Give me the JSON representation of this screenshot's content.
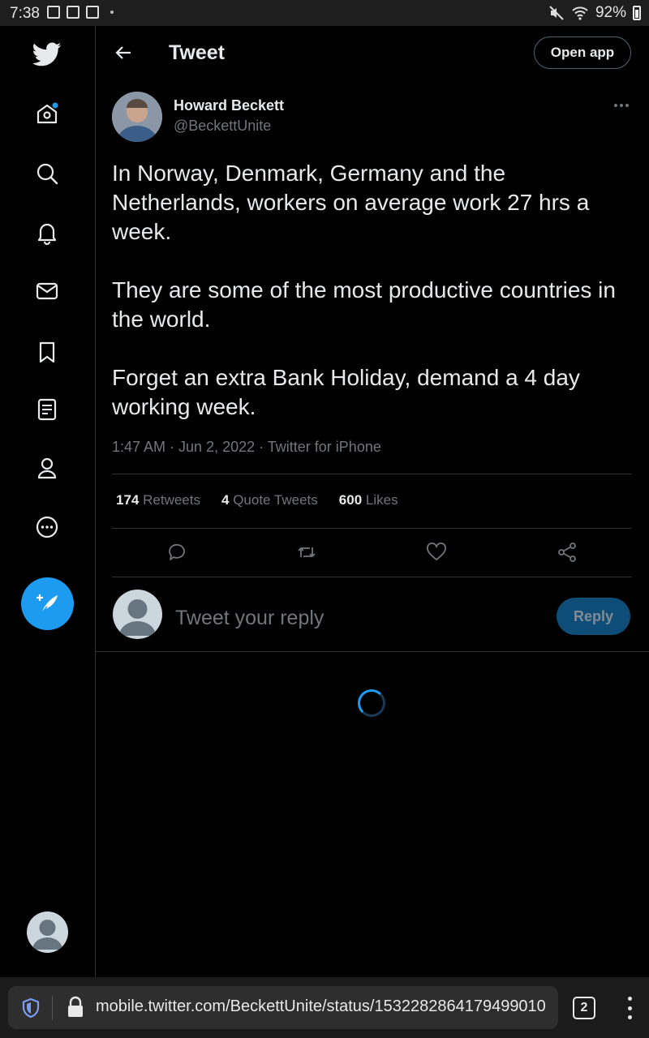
{
  "status_bar": {
    "time": "7:38",
    "battery": "92%"
  },
  "sidebar": {
    "items": [
      {
        "icon": "twitter-logo-icon"
      },
      {
        "icon": "home-icon"
      },
      {
        "icon": "search-icon"
      },
      {
        "icon": "notifications-bell-icon"
      },
      {
        "icon": "messages-envelope-icon"
      },
      {
        "icon": "bookmarks-icon"
      },
      {
        "icon": "lists-icon"
      },
      {
        "icon": "profile-icon"
      },
      {
        "icon": "more-icon"
      }
    ],
    "compose_icon": "compose-feather-icon"
  },
  "header": {
    "title": "Tweet",
    "open_app_label": "Open app"
  },
  "tweet": {
    "author_name": "Howard Beckett",
    "author_handle": "@BeckettUnite",
    "paragraphs": [
      "In Norway, Denmark, Germany and the Netherlands, workers on average work 27 hrs a week.",
      "They are some of the most productive countries in the world.",
      "Forget an extra Bank Holiday, demand a 4 day working week."
    ],
    "meta": "1:47 AM · Jun 2, 2022 · Twitter for iPhone",
    "stats": {
      "retweets_count": "174",
      "retweets_label": "Retweets",
      "quote_count": "4",
      "quote_label": "Quote Tweets",
      "likes_count": "600",
      "likes_label": "Likes"
    }
  },
  "reply": {
    "placeholder": "Tweet your reply",
    "button_label": "Reply"
  },
  "browser": {
    "url": "mobile.twitter.com/BeckettUnite/status/1532282864179499010",
    "tab_count": "2"
  },
  "colors": {
    "accent": "#1d9bf0",
    "background": "#000000",
    "muted_text": "#71767b",
    "border": "#2f3336"
  }
}
